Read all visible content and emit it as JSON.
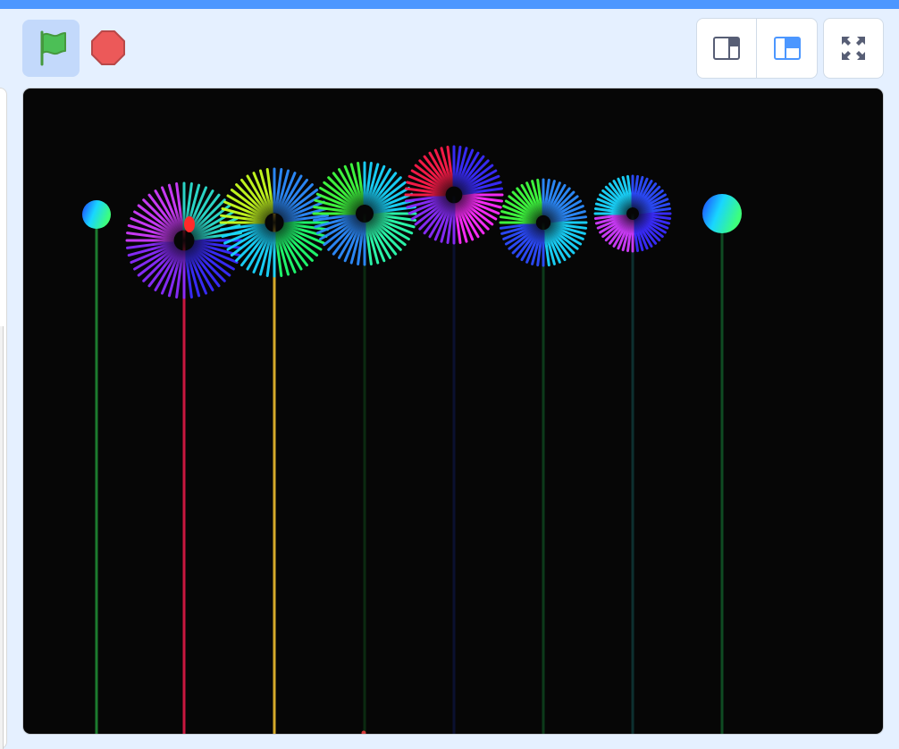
{
  "toolbar": {
    "green_flag_icon": "green-flag-icon",
    "stop_icon": "stop-sign-icon",
    "small_stage_icon": "small-stage-icon",
    "large_stage_icon": "large-stage-icon",
    "fullscreen_icon": "fullscreen-icon"
  },
  "colors": {
    "accent": "#4c97ff",
    "background": "#e5f0ff",
    "stage_background": "#060606",
    "flag_green": "#4cbf56",
    "stop_red": "#ec5959"
  },
  "stage": {
    "fireworks": [
      {
        "kind": "ball",
        "palette": [
          "#1e3cff",
          "#19d6ff",
          "#3dff7a"
        ],
        "trail": "#1c7a2e"
      },
      {
        "kind": "burst",
        "palette": [
          "#3a2cff",
          "#8a2cff",
          "#d13cff",
          "#2ce0d0"
        ],
        "trail": "#c8173f",
        "spark": "#ff2a2a"
      },
      {
        "kind": "burst",
        "palette": [
          "#20ff70",
          "#19d6ff",
          "#c8ff20",
          "#2c8cff"
        ],
        "trail": "#d4a92a"
      },
      {
        "kind": "burst",
        "palette": [
          "#2cffb0",
          "#2c8cff",
          "#40ff40",
          "#19d6ff"
        ],
        "trail": "#0b2a10"
      },
      {
        "kind": "burst",
        "palette": [
          "#ff2cff",
          "#8a2cff",
          "#ff1c4a",
          "#3a2cff"
        ],
        "trail": "#0a1030"
      },
      {
        "kind": "burst",
        "palette": [
          "#19d6ff",
          "#2c4cff",
          "#40ff40",
          "#2c8cff"
        ],
        "trail": "#0c3a1a"
      },
      {
        "kind": "burst",
        "palette": [
          "#3a2cff",
          "#d13cff",
          "#19d6ff",
          "#2c4cff"
        ],
        "trail": "#0d3030"
      },
      {
        "kind": "ball",
        "palette": [
          "#1e3cff",
          "#19d6ff",
          "#3dff7a"
        ],
        "trail": "#0f4a22"
      }
    ]
  }
}
